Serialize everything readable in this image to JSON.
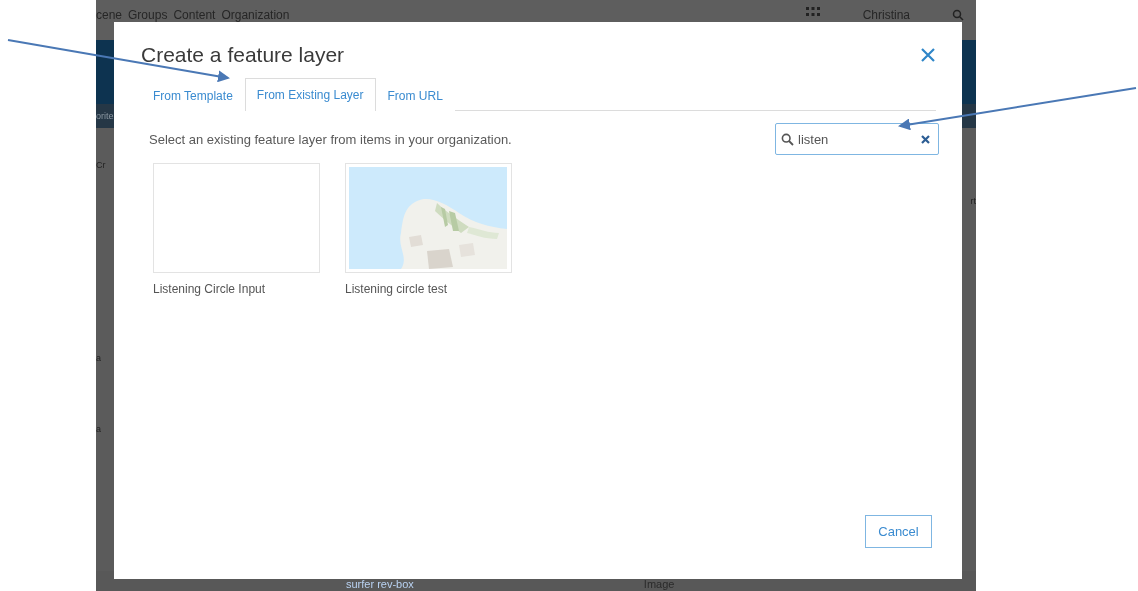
{
  "background_app": {
    "nav_items": [
      "cene",
      "Groups",
      "Content",
      "Organization"
    ],
    "user_menu": "Christina",
    "side_fragments": [
      "orite",
      "Cr",
      "a",
      "a"
    ],
    "right_fragment": "rt",
    "bottom_row": {
      "title": "surfer rev-box",
      "type": "Image"
    }
  },
  "dialog": {
    "title": "Create a feature layer",
    "tabs": [
      {
        "label": "From Template",
        "selected": false
      },
      {
        "label": "From Existing Layer",
        "selected": true
      },
      {
        "label": "From URL",
        "selected": false
      }
    ],
    "description": "Select an existing feature layer from items in your organization.",
    "search": {
      "value": "listen"
    },
    "items": [
      {
        "title": "Listening Circle Input",
        "kind": "blank"
      },
      {
        "title": "Listening circle test",
        "kind": "picture"
      }
    ],
    "buttons": [
      "Cancel"
    ]
  }
}
